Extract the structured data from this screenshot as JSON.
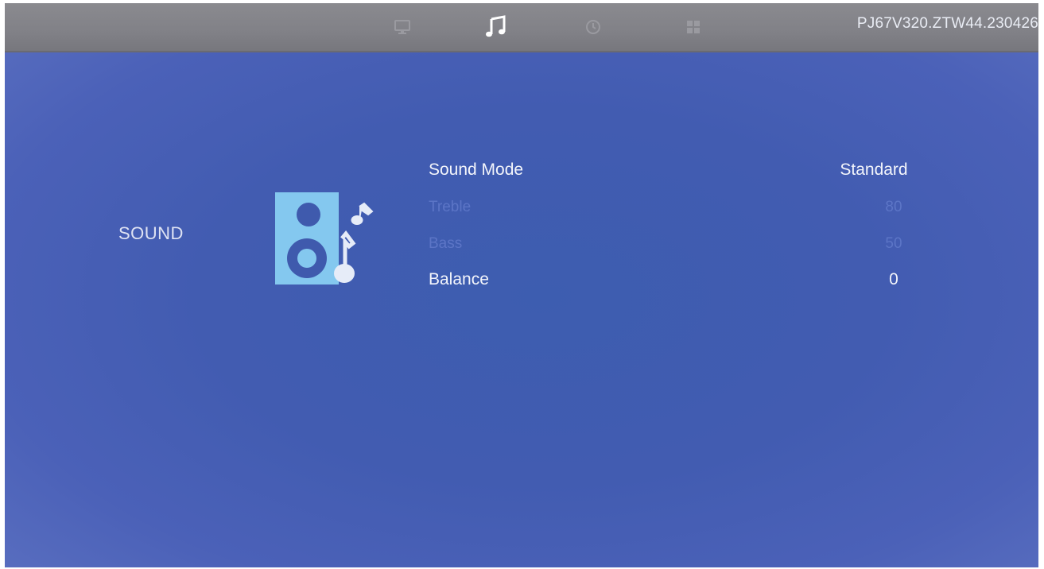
{
  "header": {
    "tabs": [
      {
        "name": "picture",
        "icon": "monitor-icon",
        "active": false
      },
      {
        "name": "sound",
        "icon": "music-note-icon",
        "active": true
      },
      {
        "name": "time",
        "icon": "clock-icon",
        "active": false
      },
      {
        "name": "setup",
        "icon": "grid-icon",
        "active": false
      }
    ],
    "firmware_version": "PJ67V320.ZTW44.230426"
  },
  "category": {
    "label": "SOUND",
    "icon": "speaker-music-icon"
  },
  "menu": {
    "items": [
      {
        "label": "Sound Mode",
        "value": "Standard",
        "enabled": true
      },
      {
        "label": "Treble",
        "value": "80",
        "enabled": false
      },
      {
        "label": "Bass",
        "value": "50",
        "enabled": false
      },
      {
        "label": "Balance",
        "value": "0",
        "enabled": true
      }
    ]
  },
  "colors": {
    "background": "#425cb1",
    "topbar": "#818187",
    "text": "#f3f5fb",
    "disabled_text": "#5c75c6",
    "icon_accent": "#84c8ef"
  }
}
